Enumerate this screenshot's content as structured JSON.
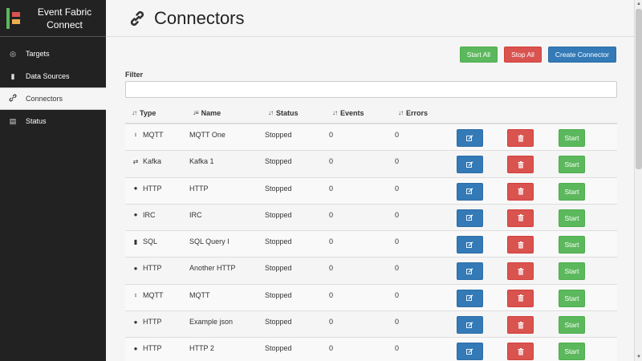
{
  "app": {
    "title_line1": "Event Fabric",
    "title_line2": "Connect"
  },
  "sidebar": {
    "items": [
      {
        "label": "Targets",
        "icon": "target-icon",
        "glyph": "◎"
      },
      {
        "label": "Data Sources",
        "icon": "database-icon",
        "glyph": "▮"
      },
      {
        "label": "Connectors",
        "icon": "link-icon",
        "glyph": "🔗"
      },
      {
        "label": "Status",
        "icon": "chart-icon",
        "glyph": "▤"
      }
    ],
    "active": "Connectors"
  },
  "page": {
    "title": "Connectors"
  },
  "actions": {
    "start_all": "Start All",
    "stop_all": "Stop All",
    "create": "Create Connector"
  },
  "filter": {
    "label": "Filter",
    "value": "",
    "placeholder": ""
  },
  "table": {
    "headers": {
      "type": "Type",
      "name": "Name",
      "status": "Status",
      "events": "Events",
      "errors": "Errors"
    },
    "rows": [
      {
        "type": "MQTT",
        "icon": "mqtt-icon",
        "glyph": "⦂",
        "name": "MQTT One",
        "status": "Stopped",
        "events": "0",
        "errors": "0"
      },
      {
        "type": "Kafka",
        "icon": "exchange-icon",
        "glyph": "⇄",
        "name": "Kafka 1",
        "status": "Stopped",
        "events": "0",
        "errors": "0"
      },
      {
        "type": "HTTP",
        "icon": "globe-icon",
        "glyph": "●",
        "name": "HTTP",
        "status": "Stopped",
        "events": "0",
        "errors": "0"
      },
      {
        "type": "IRC",
        "icon": "comment-icon",
        "glyph": "●",
        "name": "IRC",
        "status": "Stopped",
        "events": "0",
        "errors": "0"
      },
      {
        "type": "SQL",
        "icon": "database-icon",
        "glyph": "▮",
        "name": "SQL Query I",
        "status": "Stopped",
        "events": "0",
        "errors": "0"
      },
      {
        "type": "HTTP",
        "icon": "globe-icon",
        "glyph": "●",
        "name": "Another HTTP",
        "status": "Stopped",
        "events": "0",
        "errors": "0"
      },
      {
        "type": "MQTT",
        "icon": "mqtt-icon",
        "glyph": "⦂",
        "name": "MQTT",
        "status": "Stopped",
        "events": "0",
        "errors": "0"
      },
      {
        "type": "HTTP",
        "icon": "globe-icon",
        "glyph": "●",
        "name": "Example json",
        "status": "Stopped",
        "events": "0",
        "errors": "0"
      },
      {
        "type": "HTTP",
        "icon": "globe-icon",
        "glyph": "●",
        "name": "HTTP 2",
        "status": "Stopped",
        "events": "0",
        "errors": "0"
      }
    ],
    "row_actions": {
      "edit_icon": "edit-icon",
      "delete_icon": "trash-icon",
      "start_label": "Start"
    }
  },
  "colors": {
    "sidebar_bg": "#222222",
    "green": "#5cb85c",
    "red": "#d9534f",
    "blue": "#337ab7",
    "logo_orange": "#f0ad4e"
  }
}
